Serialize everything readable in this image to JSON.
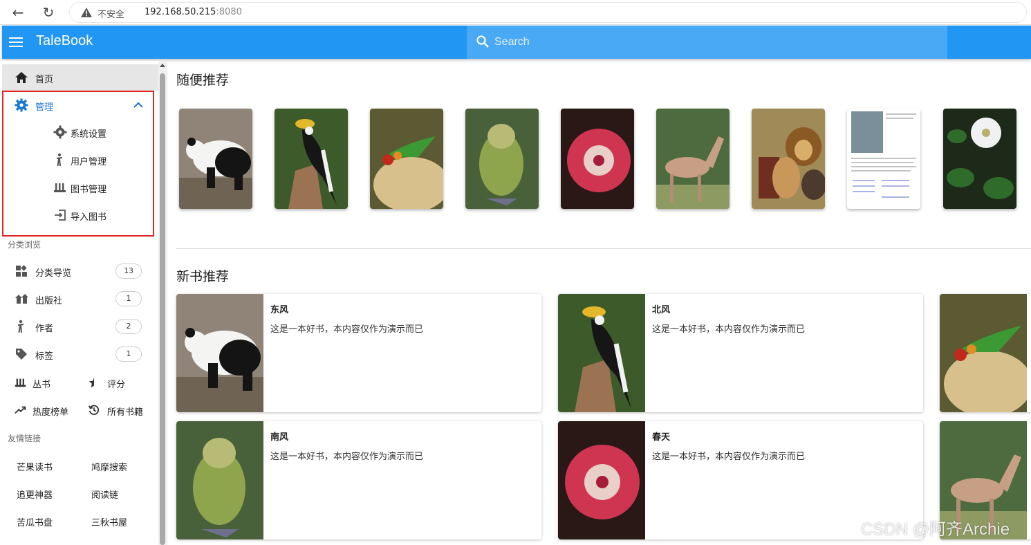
{
  "browser": {
    "insecure_label": "不安全",
    "url_host": "192.168.50.215",
    "url_port": ":8080"
  },
  "appbar": {
    "brand": "TaleBook",
    "search_placeholder": "Search",
    "color": "#2196f3"
  },
  "sidebar": {
    "home": "首页",
    "admin": {
      "label": "管理",
      "children": [
        "系统设置",
        "用户管理",
        "图书管理",
        "导入图书"
      ]
    },
    "browse_title": "分类浏览",
    "browse": [
      {
        "label": "分类导览",
        "count": "13",
        "icon": "category-icon"
      },
      {
        "label": "出版社",
        "count": "1",
        "icon": "publisher-icon"
      },
      {
        "label": "作者",
        "count": "2",
        "icon": "author-icon"
      },
      {
        "label": "标签",
        "count": "1",
        "icon": "tag-icon"
      }
    ],
    "pairs": [
      {
        "left": "丛书",
        "right": "评分"
      },
      {
        "left": "热度榜单",
        "right": "所有书籍"
      }
    ],
    "links_title": "友情链接",
    "links": [
      {
        "left": "芒果读书",
        "right": "鸠摩搜索"
      },
      {
        "left": "追更神器",
        "right": "阅读链"
      },
      {
        "left": "苦瓜书盘",
        "right": "三秋书屋"
      }
    ]
  },
  "main": {
    "random_title": "随便推荐",
    "random_covers": [
      "panda",
      "hornbill",
      "lorikeet",
      "kakapo",
      "sundew",
      "deer",
      "lions",
      "document",
      "flower"
    ],
    "new_title": "新书推荐",
    "new_books": [
      {
        "title": "东风",
        "desc": "这是一本好书，本内容仅作为演示而已",
        "cover": "panda"
      },
      {
        "title": "北风",
        "desc": "这是一本好书，本内容仅作为演示而已",
        "cover": "hornbill"
      },
      {
        "title": "南风",
        "desc": "这是一本好书，本内容仅作为演示而已",
        "cover": "kakapo"
      },
      {
        "title": "春天",
        "desc": "这是一本好书，本内容仅作为演示而已",
        "cover": "sundew"
      }
    ]
  },
  "watermark": "CSDN @阿齐Archie"
}
